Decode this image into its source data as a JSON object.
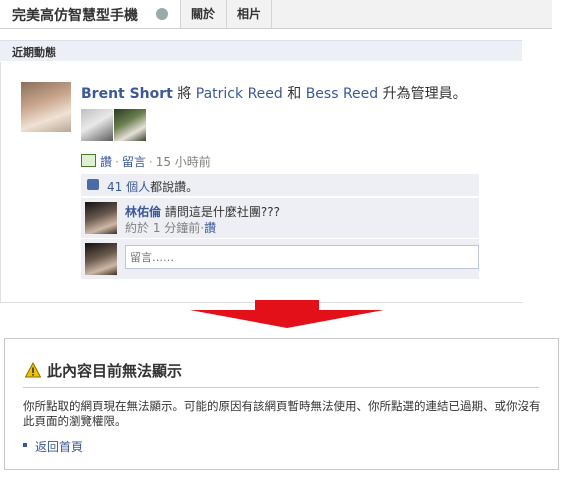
{
  "header": {
    "page_title": "完美高仿智慧型手機",
    "tabs": [
      "關於",
      "相片"
    ]
  },
  "section": {
    "title": "近期動態"
  },
  "story": {
    "actor": "Brent Short",
    "verb": " 將 ",
    "person1": "Patrick Reed",
    "conj": " 和 ",
    "person2": "Bess Reed",
    "action": " 升為管理員。",
    "like_link": "讚",
    "comment_link": "留言",
    "time": "15 小時前",
    "separator": "·"
  },
  "likes": {
    "count_link": "41 個人",
    "suffix": "都說讚。"
  },
  "comment": {
    "author": "林佑倫",
    "text": "請問這是什麼社團???",
    "time": "約於 1 分鐘前",
    "like_link": "讚"
  },
  "reply": {
    "placeholder": "留言……"
  },
  "error": {
    "title": "此內容目前無法顯示",
    "message": "你所點取的網頁現在無法顯示。可能的原因有該網頁暫時無法使用、你所點選的連結已過期、或你沒有此頁面的瀏覽權限。",
    "home_link": "返回首頁"
  },
  "colors": {
    "link": "#3b5998",
    "arrow": "#e3101a",
    "warning": "#f2c200"
  },
  "icons": [
    "globe-icon",
    "speech-bubble-icon",
    "thumbs-up-icon",
    "warning-icon",
    "down-arrow-icon"
  ]
}
